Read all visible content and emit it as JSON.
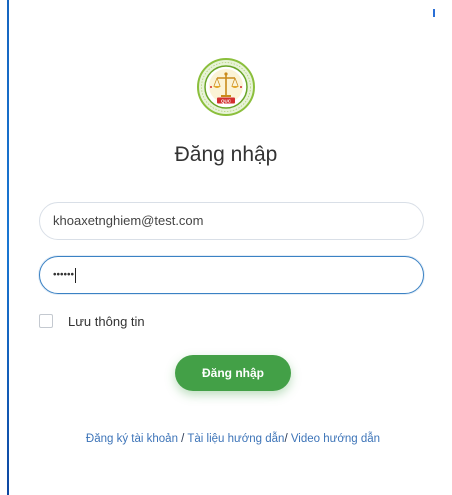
{
  "form": {
    "title": "Đăng nhập",
    "email_value": "khoaxetnghiem@test.com",
    "password_masked": "••••••",
    "remember_label": "Lưu thông tin",
    "remember_checked": false,
    "submit_label": "Đăng nhập"
  },
  "logo": {
    "badge_text": "QUC"
  },
  "footer_links": {
    "register": "Đăng ký tài khoản",
    "sep1": " / ",
    "docs": "Tài liệu hướng dẫn",
    "sep2": "/ ",
    "video": "Video hướng dẫn"
  },
  "colors": {
    "accent_green": "#43a047",
    "link_blue": "#3d74b8",
    "focus_border": "#3b82c4"
  }
}
